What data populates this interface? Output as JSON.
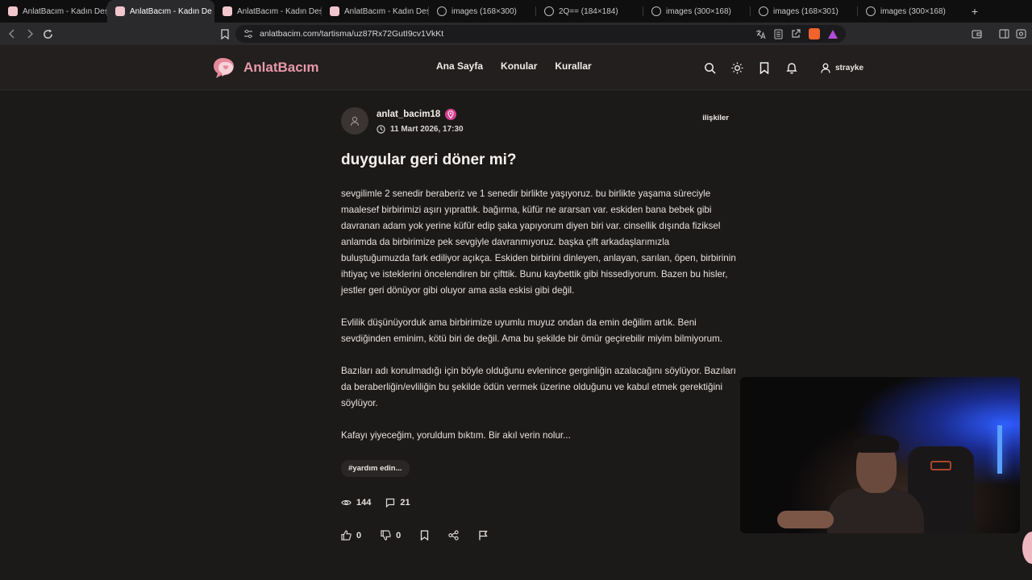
{
  "browser": {
    "tabs": [
      {
        "label": "AnlatBacım - Kadın Destek",
        "favicon": "anlatbacim-favicon",
        "active": false
      },
      {
        "label": "AnlatBacım - Kadın De",
        "favicon": "anlatbacim-favicon",
        "active": true
      },
      {
        "label": "AnlatBacım - Kadın Destek",
        "favicon": "anlatbacim-favicon",
        "active": false
      },
      {
        "label": "AnlatBacım - Kadın Destek",
        "favicon": "anlatbacim-favicon",
        "active": false
      },
      {
        "label": "images (168×300)",
        "favicon": "globe-icon",
        "active": false
      },
      {
        "label": "2Q== (184×184)",
        "favicon": "globe-icon",
        "active": false
      },
      {
        "label": "images (300×168)",
        "favicon": "globe-icon",
        "active": false
      },
      {
        "label": "images (168×301)",
        "favicon": "globe-icon",
        "active": false
      },
      {
        "label": "images (300×168)",
        "favicon": "globe-icon",
        "active": false
      }
    ],
    "close_glyph": "×",
    "newtab_glyph": "+",
    "url": "anlatbacim.com/tartisma/uz87Rx72GutI9cv1VkKt"
  },
  "site": {
    "brand": "AnlatBacım",
    "brand_color": "#e89aa8",
    "nav": [
      "Ana Sayfa",
      "Konular",
      "Kurallar"
    ],
    "username": "strayke"
  },
  "post": {
    "author": "anlat_bacim18",
    "date": "11 Mart 2026, 17:30",
    "category": "ilişkiler",
    "title": "duygular geri döner mi?",
    "paragraphs": [
      "sevgilimle 2 senedir beraberiz ve 1 senedir birlikte yaşıyoruz. bu birlikte yaşama süreciyle maalesef birbirimizi aşırı yıprattık. bağırma, küfür ne ararsan var. eskiden bana bebek gibi davranan adam yok yerine küfür edip şaka yapıyorum diyen biri var. cinsellik dışında fiziksel anlamda da birbirimize pek sevgiyle davranmıyoruz. başka çift arkadaşlarımızla buluştuğumuzda fark ediliyor açıkça. Eskiden birbirini dinleyen, anlayan, sarılan, öpen, birbirinin ihtiyaç ve isteklerini öncelendiren bir çifttik. Bunu kaybettik gibi hissediyorum. Bazen bu hisler, jestler geri dönüyor gibi oluyor ama asla eskisi gibi değil.",
      "Evlilik düşünüyorduk ama birbirimize uyumlu muyuz ondan da emin değilim artık. Beni sevdiğinden eminim, kötü biri de değil. Ama bu şekilde bir ömür geçirebilir miyim bilmiyorum.",
      "Bazıları adı konulmadığı için böyle olduğunu evlenince gerginliğin azalacağını söylüyor. Bazıları da beraberliğin/evliliğin bu şekilde ödün vermek üzerine olduğunu ve kabul etmek gerektiğini söylüyor.",
      "Kafayı yiyeceğim, yoruldum bıktım. Bir akıl verin nolur..."
    ],
    "tag": "#yardım edin...",
    "views": "144",
    "comments": "21",
    "likes": "0",
    "dislikes": "0"
  },
  "colors": {
    "accent_pink": "#d6408f",
    "background": "#1c1a19"
  }
}
